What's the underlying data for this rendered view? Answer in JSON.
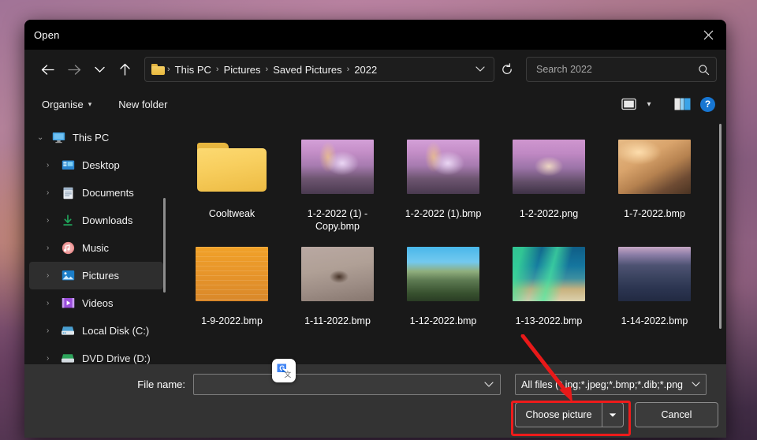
{
  "window": {
    "title": "Open",
    "close_label": "Close"
  },
  "nav": {
    "back_label": "Back",
    "forward_label": "Forward",
    "recent_label": "Recent locations",
    "up_label": "Up",
    "refresh_label": "Refresh",
    "breadcrumb": [
      "This PC",
      "Pictures",
      "Saved Pictures",
      "2022"
    ],
    "breadcrumb_separator": "›"
  },
  "search": {
    "placeholder": "Search 2022",
    "value": "",
    "icon": "search-icon"
  },
  "command_bar": {
    "organise_label": "Organise",
    "organise_caret": "▾",
    "new_folder_label": "New folder",
    "view_icon": "view-layout-icon",
    "view_caret": "▾",
    "pane_icon": "preview-pane-icon",
    "help_label": "?"
  },
  "sidebar": {
    "items": [
      {
        "label": "This PC",
        "icon": "monitor-icon",
        "chevron": "⌄",
        "expanded": true,
        "indent": false,
        "selected": false
      },
      {
        "label": "Desktop",
        "icon": "desktop-icon",
        "chevron": "›",
        "expanded": false,
        "indent": true,
        "selected": false
      },
      {
        "label": "Documents",
        "icon": "documents-icon",
        "chevron": "›",
        "expanded": false,
        "indent": true,
        "selected": false
      },
      {
        "label": "Downloads",
        "icon": "downloads-icon",
        "chevron": "›",
        "expanded": false,
        "indent": true,
        "selected": false
      },
      {
        "label": "Music",
        "icon": "music-icon",
        "chevron": "›",
        "expanded": false,
        "indent": true,
        "selected": false
      },
      {
        "label": "Pictures",
        "icon": "pictures-icon",
        "chevron": "›",
        "expanded": false,
        "indent": true,
        "selected": true
      },
      {
        "label": "Videos",
        "icon": "videos-icon",
        "chevron": "›",
        "expanded": false,
        "indent": true,
        "selected": false
      },
      {
        "label": "Local Disk (C:)",
        "icon": "disk-icon",
        "chevron": "›",
        "expanded": false,
        "indent": true,
        "selected": false
      },
      {
        "label": "DVD Drive (D:)",
        "icon": "dvd-icon",
        "chevron": "›",
        "expanded": false,
        "indent": true,
        "selected": false
      }
    ]
  },
  "files": [
    {
      "name": "Cooltweak",
      "type": "folder",
      "thumb": "none"
    },
    {
      "name": "1-2-2022 (1) - Copy.bmp",
      "type": "image",
      "thumb": "prague-night"
    },
    {
      "name": "1-2-2022 (1).bmp",
      "type": "image",
      "thumb": "prague-night"
    },
    {
      "name": "1-2-2022.png",
      "type": "image",
      "thumb": "prague-night"
    },
    {
      "name": "1-7-2022.bmp",
      "type": "image",
      "thumb": "desert-dunes"
    },
    {
      "name": "1-9-2022.bmp",
      "type": "image",
      "thumb": "orange-field"
    },
    {
      "name": "1-11-2022.bmp",
      "type": "image",
      "thumb": "bear-brush"
    },
    {
      "name": "1-12-2022.bmp",
      "type": "image",
      "thumb": "mountain-blue"
    },
    {
      "name": "1-13-2022.bmp",
      "type": "image",
      "thumb": "aurora"
    },
    {
      "name": "1-14-2022.bmp",
      "type": "image",
      "thumb": "mountain-road"
    }
  ],
  "bottom": {
    "file_name_label": "File name:",
    "file_name_value": "",
    "file_name_placeholder": "",
    "file_type_value": "All files (*.jpg;*.jpeg;*.bmp;*.dib;*.png",
    "choose_label": "Choose picture",
    "choose_caret": "▼",
    "cancel_label": "Cancel"
  },
  "overlay": {
    "google_translate_icon": "google-translate-icon",
    "highlight_color": "#ee1b1b",
    "highlight_target": "Choose picture"
  }
}
